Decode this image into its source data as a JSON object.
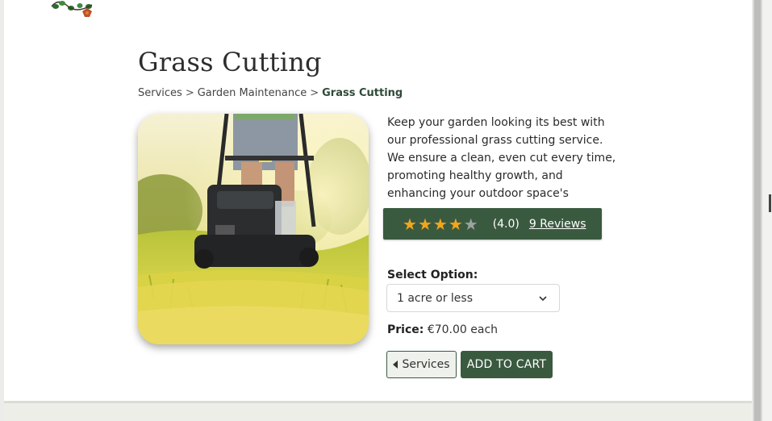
{
  "page": {
    "title": "Grass Cutting",
    "breadcrumb": {
      "items": [
        "Services",
        "Garden Maintenance"
      ],
      "separator": ">",
      "current": "Grass Cutting"
    },
    "hero_image": {
      "icon": "lawnmower-photo",
      "alt": "Grass Cutting"
    },
    "description": "Keep your garden looking its best with our professional grass cutting service. We ensure a clean, even cut every time, promoting healthy growth, and enhancing your outdoor space's appearance.",
    "rating": {
      "stars_filled": 4,
      "stars_total": 5,
      "value_text": "(4.0)",
      "reviews_text": "9 Reviews"
    },
    "option": {
      "label": "Select Option:",
      "selected": "1 acre or less"
    },
    "price": {
      "label": "Price:",
      "value": "€70.00 each"
    },
    "buttons": {
      "services_label": "Services",
      "add_to_cart_label": "ADD TO CART"
    }
  },
  "colors": {
    "brand_green": "#3a5a40",
    "star": "#f2a61d",
    "star_empty": "#9aa3a0"
  }
}
